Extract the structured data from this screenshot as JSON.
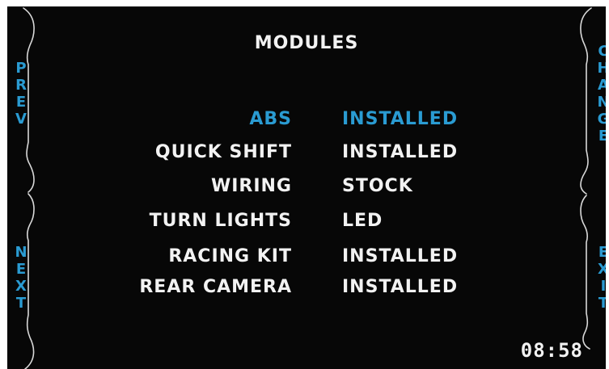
{
  "colors": {
    "background": "#070707",
    "text": "#f2f2f2",
    "accent": "#2a9bd2",
    "frame": "#d8d8d8"
  },
  "nav": {
    "prev": "PREV",
    "next": "NEXT",
    "change": "CHANGE",
    "exit": "EXIT"
  },
  "title": "MODULES",
  "modules": [
    {
      "name": "ABS",
      "status": "INSTALLED",
      "selected": true
    },
    {
      "name": "QUICK SHIFT",
      "status": "INSTALLED",
      "selected": false
    },
    {
      "name": "WIRING",
      "status": "STOCK",
      "selected": false
    },
    {
      "name": "TURN LIGHTS",
      "status": "LED",
      "selected": false
    },
    {
      "name": "RACING KIT",
      "status": "INSTALLED",
      "selected": false
    },
    {
      "name": "REAR CAMERA",
      "status": "INSTALLED",
      "selected": false
    }
  ],
  "clock": "08:58"
}
